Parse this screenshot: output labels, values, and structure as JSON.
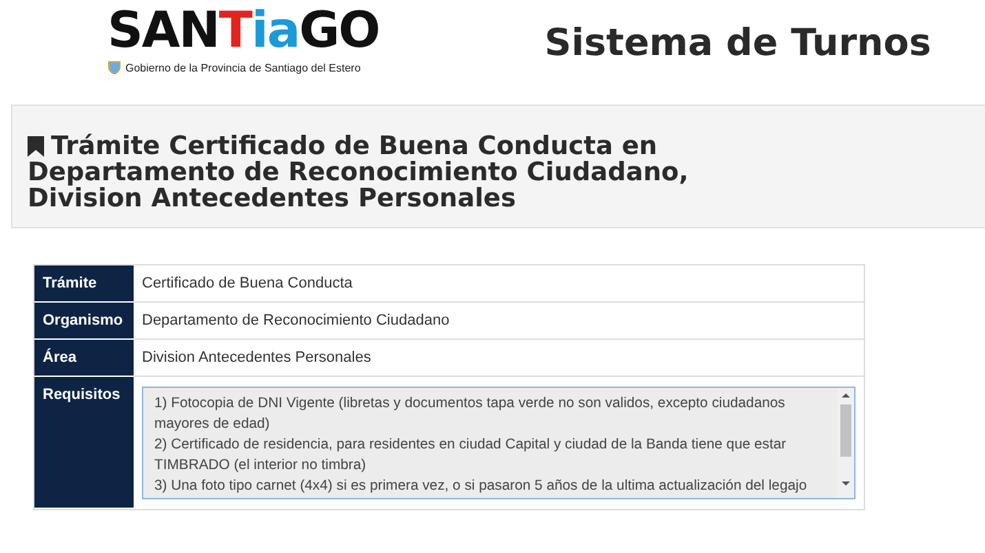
{
  "header": {
    "logo": {
      "parts": [
        {
          "text": "SAN",
          "color": "#111111"
        },
        {
          "text": "T",
          "color": "#e4231f"
        },
        {
          "text": "ia",
          "color": "#1b9ad6"
        },
        {
          "text": "GO",
          "color": "#111111"
        }
      ],
      "subtitle": "Gobierno de la Provincia de Santiago del Estero"
    },
    "app_title": "Sistema de Turnos"
  },
  "page_title": "Trámite Certificado de Buena Conducta en Departamento de Reconocimiento Ciudadano, Division Antecedentes Personales",
  "details": [
    {
      "label": "Trámite",
      "value": "Certificado de Buena Conducta"
    },
    {
      "label": "Organismo",
      "value": "Departamento de Reconocimiento Ciudadano"
    },
    {
      "label": "Área",
      "value": "Division Antecedentes Personales"
    }
  ],
  "requirements": {
    "label": "Requisitos",
    "lines": [
      "1) Fotocopia de DNI Vigente (libretas y documentos tapa verde no son validos, excepto ciudadanos mayores de edad)",
      "2) Certificado de residencia, para residentes en ciudad Capital y ciudad de la Banda tiene que estar TIMBRADO (el interior no timbra)",
      "3) Una foto tipo carnet (4x4) si es primera vez, o si pasaron 5 años de la ultima actualización del legajo"
    ]
  }
}
